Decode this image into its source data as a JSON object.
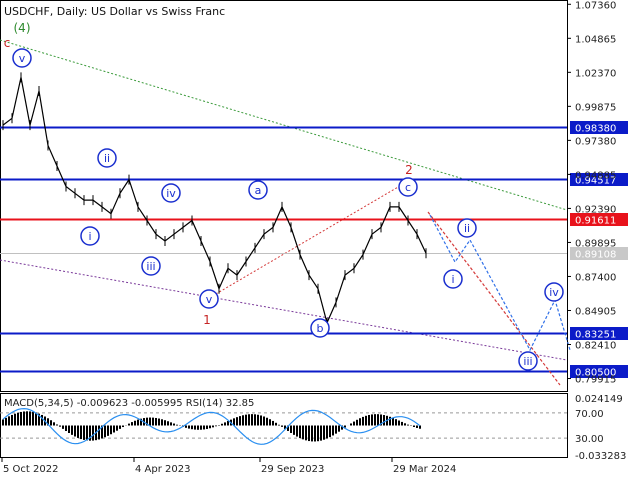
{
  "header": {
    "title": "USDCHF, Daily:  US Dollar vs Swiss Franc"
  },
  "colors": {
    "level_blue": "#0b1bc8",
    "level_red": "#e8121b",
    "wave_blue": "#1a2fcf",
    "wave_green": "#2d8a2d",
    "wave_red": "#c62424",
    "trend_green": "#3a9a3a",
    "trend_purple": "#7a3a9a",
    "trend_red": "#d43a3a",
    "forecast_blue": "#3070e8",
    "current_price_bg": "#c8c8c8",
    "price_line": "#000000",
    "macd_hist": "#000000",
    "rsi_line": "#2a8ff0"
  },
  "chart_data": [
    {
      "type": "line",
      "title": "USDCHF, Daily:  US Dollar vs Swiss Franc",
      "x": [
        "5 Oct 2022",
        "4 Apr 2023",
        "29 Sep 2023",
        "29 Mar 2024"
      ],
      "y_ticks": [
        "1.07360",
        "1.04865",
        "1.02370",
        "0.99875",
        "0.97380",
        "0.94885",
        "0.92390",
        "0.89895",
        "0.87400",
        "0.84905",
        "0.82410",
        "0.79915"
      ],
      "ylim": [
        0.79,
        1.076
      ],
      "series": [
        {
          "values": [
            [
              0,
              0.985
            ],
            [
              3,
              0.99
            ],
            [
              6,
              1.02
            ],
            [
              9,
              0.985
            ],
            [
              12,
              1.01
            ],
            [
              15,
              0.97
            ],
            [
              18,
              0.955
            ],
            [
              21,
              0.94
            ],
            [
              24,
              0.935
            ],
            [
              27,
              0.93
            ],
            [
              30,
              0.93
            ],
            [
              33,
              0.925
            ],
            [
              36,
              0.92
            ],
            [
              39,
              0.935
            ],
            [
              42,
              0.945
            ],
            [
              45,
              0.925
            ],
            [
              48,
              0.915
            ],
            [
              51,
              0.905
            ],
            [
              54,
              0.9
            ],
            [
              57,
              0.905
            ],
            [
              60,
              0.91
            ],
            [
              63,
              0.915
            ],
            [
              66,
              0.9
            ],
            [
              69,
              0.885
            ],
            [
              72,
              0.865
            ],
            [
              75,
              0.88
            ],
            [
              78,
              0.875
            ],
            [
              81,
              0.885
            ],
            [
              84,
              0.895
            ],
            [
              87,
              0.905
            ],
            [
              90,
              0.91
            ],
            [
              93,
              0.925
            ],
            [
              96,
              0.91
            ],
            [
              99,
              0.89
            ],
            [
              102,
              0.875
            ],
            [
              105,
              0.865
            ],
            [
              108,
              0.84
            ],
            [
              111,
              0.855
            ],
            [
              114,
              0.875
            ],
            [
              117,
              0.88
            ],
            [
              120,
              0.89
            ],
            [
              123,
              0.905
            ],
            [
              126,
              0.91
            ],
            [
              129,
              0.925
            ],
            [
              132,
              0.925
            ],
            [
              135,
              0.915
            ],
            [
              138,
              0.905
            ],
            [
              141,
              0.891
            ]
          ]
        }
      ],
      "horizontal_levels": [
        {
          "value": 0.9838,
          "label": "0.98380",
          "color": "#0b1bc8"
        },
        {
          "value": 0.94517,
          "label": "0.94517",
          "color": "#0b1bc8"
        },
        {
          "value": 0.91611,
          "label": "0.91611",
          "color": "#e8121b"
        },
        {
          "value": 0.83251,
          "label": "0.83251",
          "color": "#0b1bc8"
        },
        {
          "value": 0.805,
          "label": "0.80500",
          "color": "#0b1bc8"
        }
      ],
      "current_price": {
        "value": 0.89108,
        "label": "0.89108"
      },
      "wave_labels": [
        {
          "text": "(4)",
          "color": "#2d8a2d"
        },
        {
          "text": "c",
          "color": "#c62424"
        },
        {
          "text": "v",
          "color": "#1a2fcf",
          "circled": true
        },
        {
          "text": "i",
          "color": "#1a2fcf",
          "circled": true
        },
        {
          "text": "ii",
          "color": "#1a2fcf",
          "circled": true
        },
        {
          "text": "iii",
          "color": "#1a2fcf",
          "circled": true
        },
        {
          "text": "iv",
          "color": "#1a2fcf",
          "circled": true
        },
        {
          "text": "v",
          "color": "#1a2fcf",
          "circled": true
        },
        {
          "text": "1",
          "color": "#c62424"
        },
        {
          "text": "a",
          "color": "#1a2fcf",
          "circled": true
        },
        {
          "text": "b",
          "color": "#1a2fcf",
          "circled": true
        },
        {
          "text": "2",
          "color": "#c62424"
        },
        {
          "text": "c",
          "color": "#1a2fcf",
          "circled": true
        },
        {
          "text": "i",
          "color": "#1a2fcf",
          "circled": true
        },
        {
          "text": "ii",
          "color": "#1a2fcf",
          "circled": true
        },
        {
          "text": "iii",
          "color": "#1a2fcf",
          "circled": true
        },
        {
          "text": "iv",
          "color": "#1a2fcf",
          "circled": true
        }
      ],
      "grid": false
    },
    {
      "type": "line",
      "title": "MACD(5,34,5) -0.009623 -0.005995 RSI(14) 32.85",
      "y_ticks": [
        "0.024149",
        "70.00",
        "30.00",
        "-0.033283"
      ],
      "macd": {
        "label": "MACD(5,34,5)",
        "main": -0.009623,
        "signal": -0.005995
      },
      "rsi": {
        "label": "RSI(14)",
        "value": 32.85,
        "levels": [
          70,
          30
        ]
      },
      "grid": false
    }
  ]
}
